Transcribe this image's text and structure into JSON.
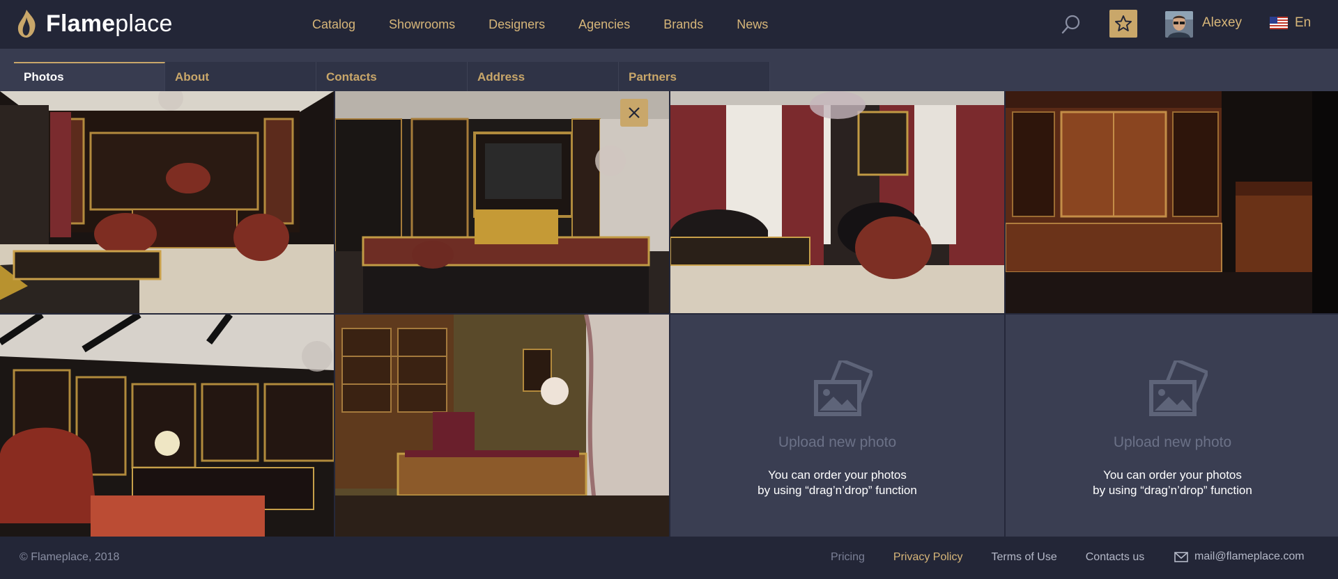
{
  "header": {
    "logo_bold": "Flame",
    "logo_light": "place",
    "nav": [
      {
        "label": "Catalog"
      },
      {
        "label": "Showrooms"
      },
      {
        "label": "Designers"
      },
      {
        "label": "Agencies"
      },
      {
        "label": "Brands"
      },
      {
        "label": "News"
      }
    ],
    "user_name": "Alexey",
    "language": "En"
  },
  "tabs": [
    {
      "label": "Photos",
      "active": true
    },
    {
      "label": "About"
    },
    {
      "label": "Contacts"
    },
    {
      "label": "Address"
    },
    {
      "label": "Partners"
    }
  ],
  "upload_slots": [
    {
      "title": "Upload new photo",
      "hint_line1": "You can order your photos",
      "hint_line2": "by using “drag’n’drop” function"
    },
    {
      "title": "Upload new photo",
      "hint_line1": "You can order your photos",
      "hint_line2": "by using “drag’n’drop” function"
    }
  ],
  "footer": {
    "copyright": "© Flameplace, 2018",
    "links": [
      {
        "label": "Pricing"
      },
      {
        "label": "Privacy Policy"
      },
      {
        "label": "Terms of Use"
      },
      {
        "label": "Contacts us"
      }
    ],
    "email": "mail@flameplace.com"
  },
  "colors": {
    "accent": "#c9a76a",
    "header_bg": "#232637",
    "page_bg": "#383c50"
  }
}
